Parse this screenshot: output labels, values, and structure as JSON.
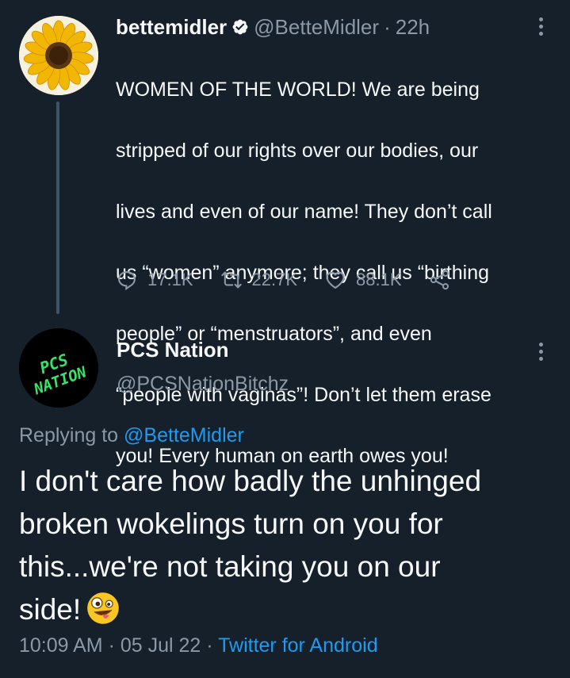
{
  "parent_tweet": {
    "display_name": "bettemidler",
    "handle": "@BetteMidler",
    "separator": "·",
    "time_ago": "22h",
    "verified": true,
    "text": "WOMEN OF THE WORLD! We are being stripped of our rights over our bodies, our lives and even of our name! They don’t call us “women” anymore; they call us “birthing people” or “menstruators”, and even “people with vaginas”!  Don’t let them erase you! Every human on earth owes you!",
    "text_lines": [
      "WOMEN OF THE WORLD! We are being",
      "stripped of our rights over our bodies, our",
      "lives and even of our name! They don’t call",
      "us “women” anymore; they call us “birthing",
      "people” or “menstruators”, and even",
      "“people with vaginas”!  Don’t let them erase",
      "you! Every human on earth owes you!"
    ],
    "actions": {
      "reply_count": "17.1K",
      "retweet_count": "22.7K",
      "like_count": "88.1K"
    }
  },
  "reply_tweet": {
    "display_name": "PCS Nation",
    "handle": "@PCSNationBitchz",
    "avatar_text": "PCS NATION",
    "replying_to_label": "Replying to",
    "replying_to_handle": "@BetteMidler",
    "text_lines": [
      "I don't care how badly the unhinged",
      "broken wokelings turn on you for",
      "this...we're not taking you on our",
      "side!"
    ],
    "emoji": "zany-face",
    "time": "10:09 AM",
    "date": "05 Jul 22",
    "separator": "·",
    "source": "Twitter for Android"
  },
  "colors": {
    "background": "#15202b",
    "text_primary": "#f7f9f9",
    "text_secondary": "#8b98a5",
    "accent": "#1d9bf0",
    "thread_line": "#3d5466",
    "pcs_green": "#39e06a"
  },
  "icons": [
    "sunflower-avatar",
    "verified-badge-icon",
    "more-icon",
    "reply-icon",
    "retweet-icon",
    "like-icon",
    "share-icon",
    "pcs-nation-avatar",
    "zany-face-emoji"
  ]
}
